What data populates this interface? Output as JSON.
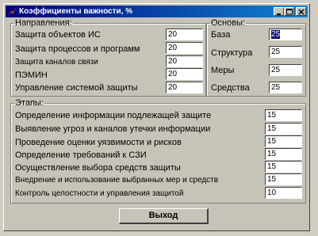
{
  "window": {
    "title": "Коэффициенты важности, %"
  },
  "directions": {
    "legend": "Направления:",
    "rows": [
      {
        "label": "Защита объектов ИС",
        "value": "20"
      },
      {
        "label": "Защита процессов и программ",
        "value": "20"
      },
      {
        "label": "Защита каналов связи",
        "value": "20"
      },
      {
        "label": "ПЭМИН",
        "value": "20"
      },
      {
        "label": "Управление системой защиты",
        "value": "20"
      }
    ]
  },
  "basics": {
    "legend": "Основы:",
    "rows": [
      {
        "label": "База",
        "value": "25"
      },
      {
        "label": "Структура",
        "value": "25"
      },
      {
        "label": "Меры",
        "value": "25"
      },
      {
        "label": "Средства",
        "value": "25"
      }
    ]
  },
  "stages": {
    "legend": "Этапы:",
    "rows": [
      {
        "label": "Определение информации подлежащей защите",
        "value": "15"
      },
      {
        "label": "Выявление угроз и каналов утечки информации",
        "value": "15"
      },
      {
        "label": "Проведение оценки уязвимости и рисков",
        "value": "15"
      },
      {
        "label": "Определение требований к СЗИ",
        "value": "15"
      },
      {
        "label": "Осуществление выбора средств защиты",
        "value": "15"
      },
      {
        "label": "Внедрение и использование выбранных мер и средств",
        "value": "15"
      },
      {
        "label": "Контроль целостности и управления защитой",
        "value": "10"
      }
    ]
  },
  "buttons": {
    "exit": "Выход"
  }
}
